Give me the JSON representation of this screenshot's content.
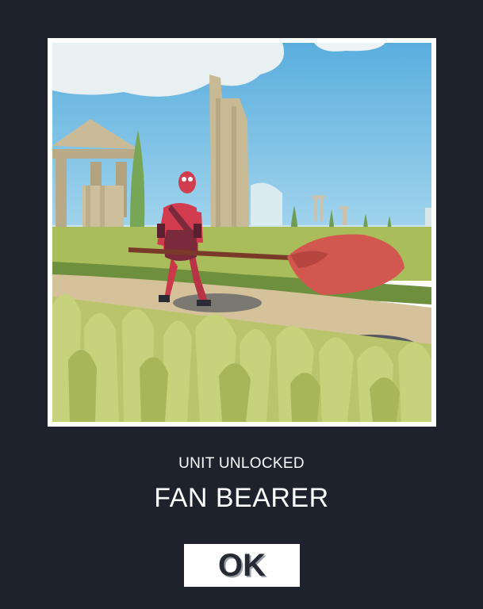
{
  "popup": {
    "subtitle": "UNIT UNLOCKED",
    "unit_name": "FAN BEARER",
    "ok_label": "OK"
  },
  "colors": {
    "background": "#1e222c",
    "frame": "#ffffff",
    "unit_red": "#d03a4c",
    "fan_red": "#d2574f",
    "grass": "#b8c466",
    "sky": "#5cb6e4"
  }
}
